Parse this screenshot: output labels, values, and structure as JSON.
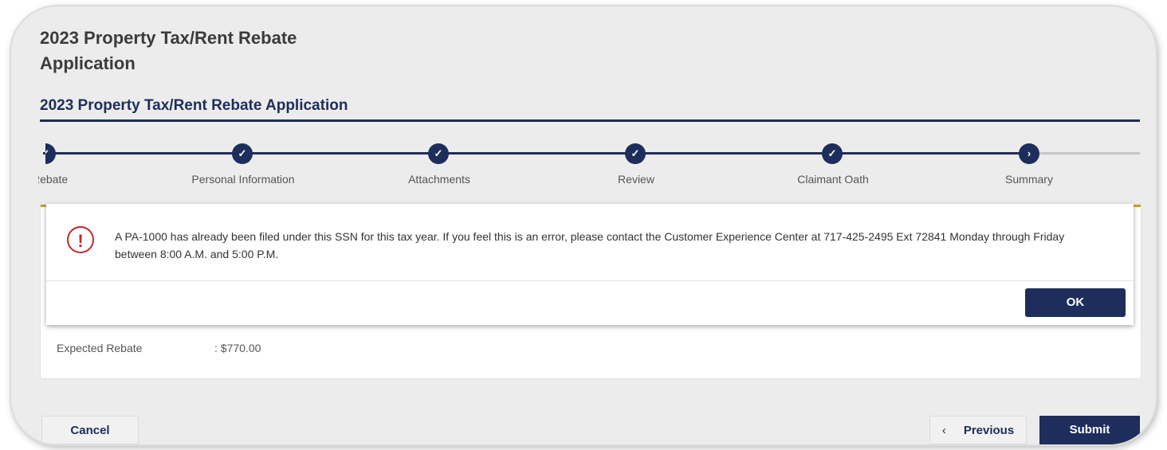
{
  "page": {
    "title_line1": "2023 Property Tax/Rent Rebate",
    "title_line2": "Application",
    "section_title": "2023 Property Tax/Rent Rebate Application"
  },
  "stepper": {
    "steps": [
      {
        "label": "Rebate",
        "status": "complete"
      },
      {
        "label": "Personal Information",
        "status": "complete"
      },
      {
        "label": "Attachments",
        "status": "complete"
      },
      {
        "label": "Review",
        "status": "complete"
      },
      {
        "label": "Claimant Oath",
        "status": "complete"
      },
      {
        "label": "Summary",
        "status": "current"
      }
    ],
    "complete_icon": "check-icon",
    "current_icon": "chevron-right-icon"
  },
  "summary": {
    "expected_rebate_label": "Expected Rebate",
    "expected_rebate_value": ": $770.00"
  },
  "modal": {
    "icon": "exclamation-icon",
    "message": "A PA-1000 has already been filed under this SSN for this tax year. If you feel this is an error, please contact the Customer Experience Center at 717-425-2495 Ext 72841 Monday through Friday between 8:00 A.M. and 5:00 P.M.",
    "ok_label": "OK"
  },
  "footer": {
    "cancel_label": "Cancel",
    "previous_label": "Previous",
    "submit_label": "Submit"
  },
  "colors": {
    "primary": "#1d2e5c",
    "error": "#c0282d",
    "accent_bar": "#c9a227"
  }
}
